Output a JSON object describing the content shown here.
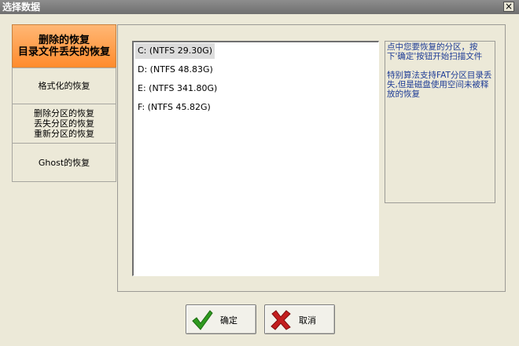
{
  "window": {
    "title": "选择数据",
    "close_label": "×"
  },
  "tabs": [
    {
      "lines": [
        "删除的恢复",
        "目录文件丢失的恢复"
      ],
      "active": true
    },
    {
      "lines": [
        "格式化的恢复"
      ],
      "active": false
    },
    {
      "lines": [
        "删除分区的恢复",
        "丢失分区的恢复",
        "重新分区的恢复"
      ],
      "active": false
    },
    {
      "lines": [
        "Ghost的恢复"
      ],
      "active": false
    }
  ],
  "partitions": [
    {
      "label": "C:  (NTFS 29.30G)",
      "selected": true
    },
    {
      "label": "D:  (NTFS 48.83G)",
      "selected": false
    },
    {
      "label": "E:  (NTFS 341.80G)",
      "selected": false
    },
    {
      "label": "F:  (NTFS 45.82G)",
      "selected": false
    }
  ],
  "info": {
    "line1": "点中您要恢复的分区，按下'确定'按钮开始扫描文件",
    "line2": "特别算法支持FAT分区目录丢失,但是磁盘使用空间未被释放的恢复"
  },
  "buttons": {
    "ok_label": "确定",
    "cancel_label": "取消"
  },
  "colors": {
    "active_tab": "#ff9a45",
    "info_text": "#1e3c96",
    "ok_icon": "#2e9a1e",
    "cancel_icon": "#c41e1e"
  },
  "icons": {
    "ok": "checkmark-icon",
    "cancel": "x-mark-icon"
  }
}
